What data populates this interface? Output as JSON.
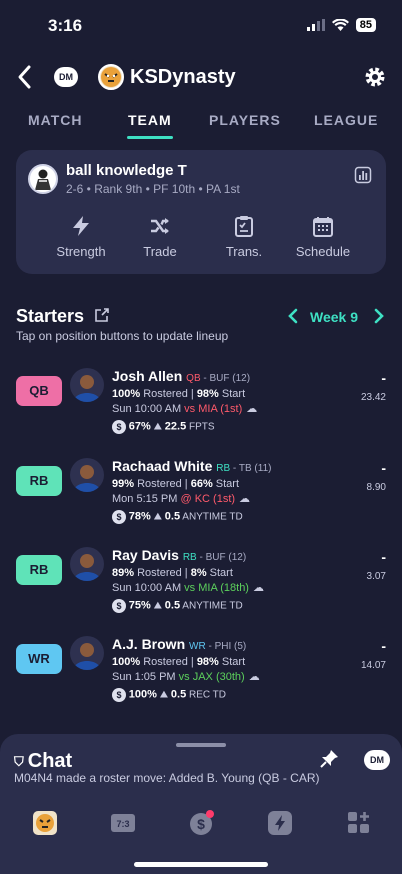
{
  "status": {
    "time": "3:16",
    "battery": "85"
  },
  "header": {
    "title": "KSDynasty",
    "dm_label": "DM"
  },
  "tabs": [
    {
      "label": "MATCH"
    },
    {
      "label": "TEAM"
    },
    {
      "label": "PLAYERS"
    },
    {
      "label": "LEAGUE"
    }
  ],
  "active_tab": "TEAM",
  "team": {
    "name": "ball knowledge T",
    "meta": "2-6 • Rank 9th • PF 10th • PA 1st",
    "actions": [
      {
        "label": "Strength",
        "icon": "bolt-icon"
      },
      {
        "label": "Trade",
        "icon": "shuffle-icon"
      },
      {
        "label": "Trans.",
        "icon": "clipboard-icon"
      },
      {
        "label": "Schedule",
        "icon": "calendar-icon"
      }
    ]
  },
  "starters": {
    "title": "Starters",
    "subtitle": "Tap on position buttons to update lineup",
    "week": "Week 9",
    "players": [
      {
        "slot": "QB",
        "slot_color": "#ee6fa6",
        "name": "Josh Allen",
        "pos": "QB",
        "pos_color": "#ff5a6b",
        "team": " - BUF (12)",
        "rostered": "100%",
        "rostered_label": " Rostered | ",
        "start": "98%",
        "start_label": " Start",
        "game_time": "Sun 10:00 AM ",
        "opp": "vs MIA (1st)",
        "opp_color": "#ff5a6b",
        "coin": "$",
        "stat1": "67%",
        "stat2": "22.5",
        "stat2_label": " FPTS",
        "score": "-",
        "proj": "23.42"
      },
      {
        "slot": "RB",
        "slot_color": "#5fe3b8",
        "name": "Rachaad White",
        "pos": "RB",
        "pos_color": "#3ee0c3",
        "team": " - TB (11)",
        "rostered": "99%",
        "rostered_label": " Rostered | ",
        "start": "66%",
        "start_label": " Start",
        "game_time": "Mon 5:15 PM ",
        "opp": "@ KC (1st)",
        "opp_color": "#ff5a6b",
        "coin": "$",
        "stat1": "78%",
        "stat2": "0.5",
        "stat2_label": " ANYTIME TD",
        "score": "-",
        "proj": "8.90"
      },
      {
        "slot": "RB",
        "slot_color": "#5fe3b8",
        "name": "Ray Davis",
        "pos": "RB",
        "pos_color": "#3ee0c3",
        "team": " - BUF (12)",
        "rostered": "89%",
        "rostered_label": " Rostered | ",
        "start": "8%",
        "start_label": " Start",
        "game_time": "Sun 10:00 AM ",
        "opp": "vs MIA (18th)",
        "opp_color": "#5cd05c",
        "coin": "$",
        "stat1": "75%",
        "stat2": "0.5",
        "stat2_label": " ANYTIME TD",
        "score": "-",
        "proj": "3.07"
      },
      {
        "slot": "WR",
        "slot_color": "#5fc7f2",
        "name": "A.J. Brown",
        "pos": "WR",
        "pos_color": "#5fc7f2",
        "team": " - PHI (5)",
        "rostered": "100%",
        "rostered_label": " Rostered | ",
        "start": "98%",
        "start_label": " Start",
        "game_time": "Sun 1:05 PM ",
        "opp": "vs JAX (30th)",
        "opp_color": "#5cd05c",
        "coin": "$",
        "stat1": "100%",
        "stat2": "0.5",
        "stat2_label": " REC TD",
        "score": "-",
        "proj": "14.07"
      }
    ]
  },
  "chat": {
    "title": "Chat",
    "preview": "M04N4 made a roster move: Added B. Young (QB - CAR)",
    "dm_label": "DM",
    "nav": [
      {
        "icon": "team-logo-icon"
      },
      {
        "icon": "scoreboard-icon",
        "label": "7:3"
      },
      {
        "icon": "dollar-icon"
      },
      {
        "icon": "bolt-icon"
      },
      {
        "icon": "grid-plus-icon"
      }
    ]
  }
}
